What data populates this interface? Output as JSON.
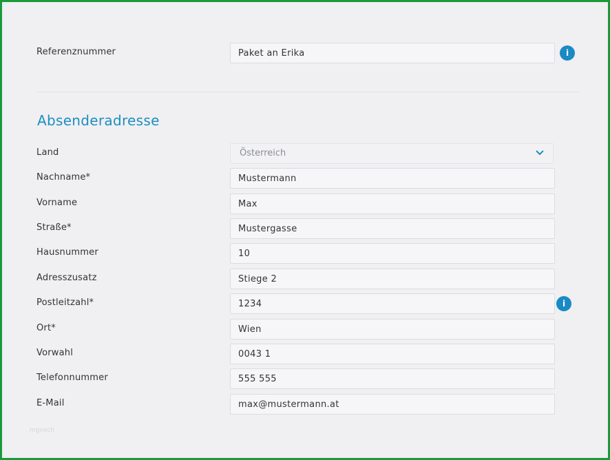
{
  "reference": {
    "label": "Referenznummer",
    "value": "Paket an Erika",
    "info_icon": "info-icon",
    "info_glyph": "i"
  },
  "sender": {
    "title": "Absenderadresse",
    "country": {
      "label": "Land",
      "value": "Österreich",
      "chevron_icon": "chevron-down-icon"
    },
    "lastname": {
      "label": "Nachname*",
      "value": "Mustermann"
    },
    "firstname": {
      "label": "Vorname",
      "value": "Max"
    },
    "street": {
      "label": "Straße*",
      "value": "Mustergasse"
    },
    "housenumber": {
      "label": "Hausnummer",
      "value": "10"
    },
    "addition": {
      "label": "Adresszusatz",
      "value": "Stiege 2"
    },
    "postcode": {
      "label": "Postleitzahl*",
      "value": "1234",
      "info_icon": "info-icon",
      "info_glyph": "i"
    },
    "city": {
      "label": "Ort*",
      "value": "Wien"
    },
    "areacode": {
      "label": "Vorwahl",
      "value": "0043 1"
    },
    "phone": {
      "label": "Telefonnummer",
      "value": "555 555"
    },
    "email": {
      "label": "E-Mail",
      "value": "max@mustermann.at"
    }
  },
  "watermark": "mgvech",
  "colors": {
    "accent": "#1b8fc0",
    "info_bg": "#1a8ac4",
    "frame_border": "#1a9a3a",
    "page_bg": "#f0eff2"
  }
}
